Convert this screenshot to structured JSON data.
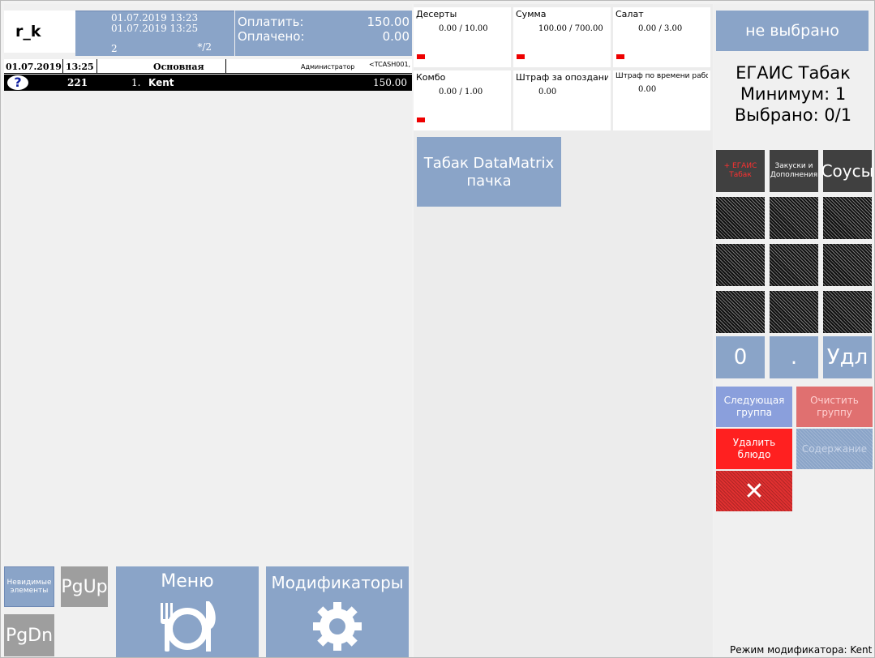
{
  "header": {
    "station": "r_k",
    "date_open": "01.07.2019 13:23",
    "date_print": "01.07.2019 13:25",
    "check_count": "2",
    "guests": "*/2",
    "pay_label": "Оплатить:",
    "pay_value": "150.00",
    "paid_label": "Оплачено:",
    "paid_value": "0.00"
  },
  "order_header": {
    "date": "01.07.2019",
    "time": "13:25",
    "type": "Основная",
    "waiter": "Администратор",
    "cash": "<TCASH001,"
  },
  "order_rows": [
    {
      "code": "221",
      "pos": "1.",
      "name": "Kent",
      "price": "150.00"
    }
  ],
  "left_buttons": {
    "invisible": "Невидимые элементы",
    "pgup": "PgUp",
    "pgdn": "PgDn",
    "menu": "Меню",
    "modifiers": "Модификаторы"
  },
  "limits": [
    {
      "title": "Десерты",
      "value": "0.00 / 10.00"
    },
    {
      "title": "Сумма",
      "value": "100.00 / 700.00"
    },
    {
      "title": "Салат",
      "value": "0.00 / 3.00"
    },
    {
      "title": "Комбо",
      "value": "0.00 / 1.00"
    },
    {
      "title": "Штраф за опоздание",
      "value": "0.00"
    },
    {
      "title": "Штраф по времени работы",
      "value": "0.00"
    }
  ],
  "modifier_item": "Табак DataMatrix пачка",
  "right": {
    "not_selected": "не выбрано",
    "group_name": "ЕГАИС Табак",
    "minimum": "Минимум: 1",
    "selected": "Выбрано: 0/1",
    "groups": [
      "+ ЕГАИС Табак",
      "Закуски и Дополнения",
      "Соусы"
    ],
    "num_zero": "0",
    "num_dot": ".",
    "num_del": "Удл",
    "next_group": "Следующая группа",
    "clear_group": "Очистить группу",
    "delete_dish": "Удалить блюдо",
    "content": "Содержание",
    "close": "✕",
    "status": "Режим модификатора: Kent"
  },
  "colors": {
    "accent": "#8aa4c8",
    "danger": "#ff2020",
    "limit_bar": "#ee0000"
  }
}
